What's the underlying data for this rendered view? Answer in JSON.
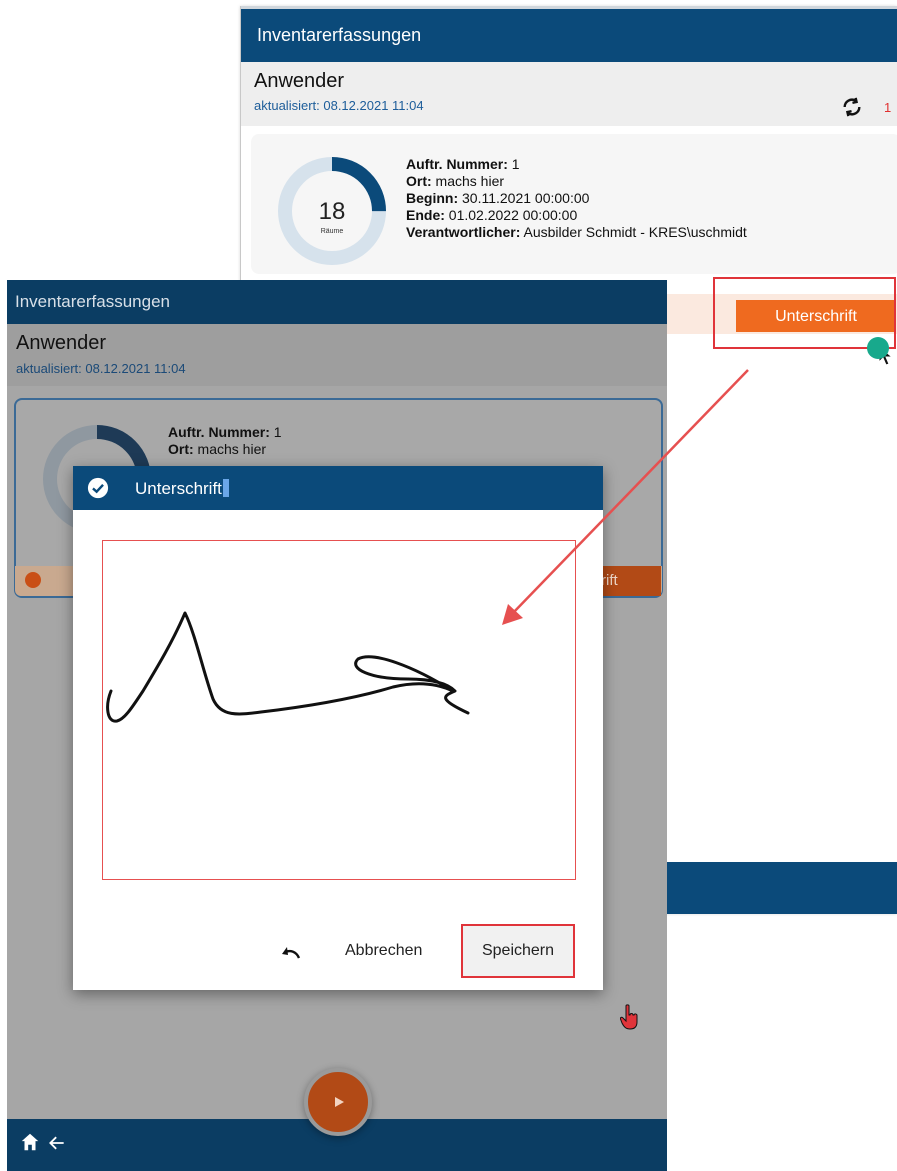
{
  "back_screen": {
    "app_title": "Inventarerfassungen",
    "user": "Anwender",
    "updated": "aktualisiert: 08.12.2021 11:04",
    "sync_count": "1",
    "order": {
      "rooms_count": "18",
      "rooms_label": "Räume",
      "number_label": "Auftr. Nummer:",
      "number_value": " 1",
      "location_label": "Ort:",
      "location_value": " machs hier",
      "start_label": "Beginn:",
      "start_value": " 30.11.2021 00:00:00",
      "end_label": "Ende:",
      "end_value": " 01.02.2022 00:00:00",
      "responsible_label": "Verantwortlicher:",
      "responsible_value": " Ausbilder Schmidt - KRES\\uschmidt",
      "progress_fraction": 0.25
    },
    "sign_button": "Unterschrift"
  },
  "front_screen": {
    "app_title": "Inventarerfassungen",
    "user": "Anwender",
    "updated": "aktualisiert: 08.12.2021 11:04",
    "order": {
      "number_label": "Auftr. Nummer:",
      "number_value": " 1",
      "location_label": "Ort:",
      "location_value": " machs hier"
    },
    "strip_button_fragment": "rift"
  },
  "dialog": {
    "title": "Unterschrift",
    "cancel_label": "Abbrechen",
    "save_label": "Speichern"
  },
  "colors": {
    "primary": "#0b4a7a",
    "accent": "#ef6a1f",
    "highlight": "#e0343a"
  }
}
